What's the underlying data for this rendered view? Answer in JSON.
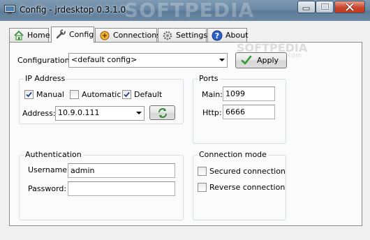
{
  "window": {
    "title": "Config - jrdesktop 0.3.1.0",
    "watermark_title": "SOFTPEDIA",
    "watermark_panel": "SOFTPEDIA",
    "watermark_url": "www.softpedia.com"
  },
  "tabs": [
    {
      "label": "Home",
      "icon": "home-icon",
      "selected": false
    },
    {
      "label": "Config",
      "icon": "wrench-icon",
      "selected": true
    },
    {
      "label": "Connections",
      "icon": "connections-icon",
      "selected": false
    },
    {
      "label": "Settings",
      "icon": "gear-icon",
      "selected": false
    },
    {
      "label": "About",
      "icon": "help-icon",
      "selected": false
    }
  ],
  "config": {
    "label": "Configuration:",
    "selected": "<default config>",
    "apply_label": "Apply"
  },
  "ip": {
    "title": "IP Address",
    "manual_label": "Manual",
    "manual_checked": true,
    "automatic_label": "Automatic",
    "automatic_checked": false,
    "default_label": "Default",
    "default_checked": true,
    "address_label": "Address:",
    "address_value": "10.9.0.111"
  },
  "ports": {
    "title": "Ports",
    "main_label": "Main:",
    "main_value": "1099",
    "http_label": "Http:",
    "http_value": "6666"
  },
  "auth": {
    "title": "Authentication",
    "username_label": "Username:",
    "username_value": "admin",
    "password_label": "Password:",
    "password_value": ""
  },
  "mode": {
    "title": "Connection mode",
    "secured_label": "Secured connection",
    "secured_checked": false,
    "reverse_label": "Reverse connection",
    "reverse_checked": false
  },
  "colors": {
    "titlebar": "#6a88a4",
    "panel": "#fbfbfb",
    "group_border": "#d5dfe5",
    "apply_check": "#2e9a2e"
  }
}
